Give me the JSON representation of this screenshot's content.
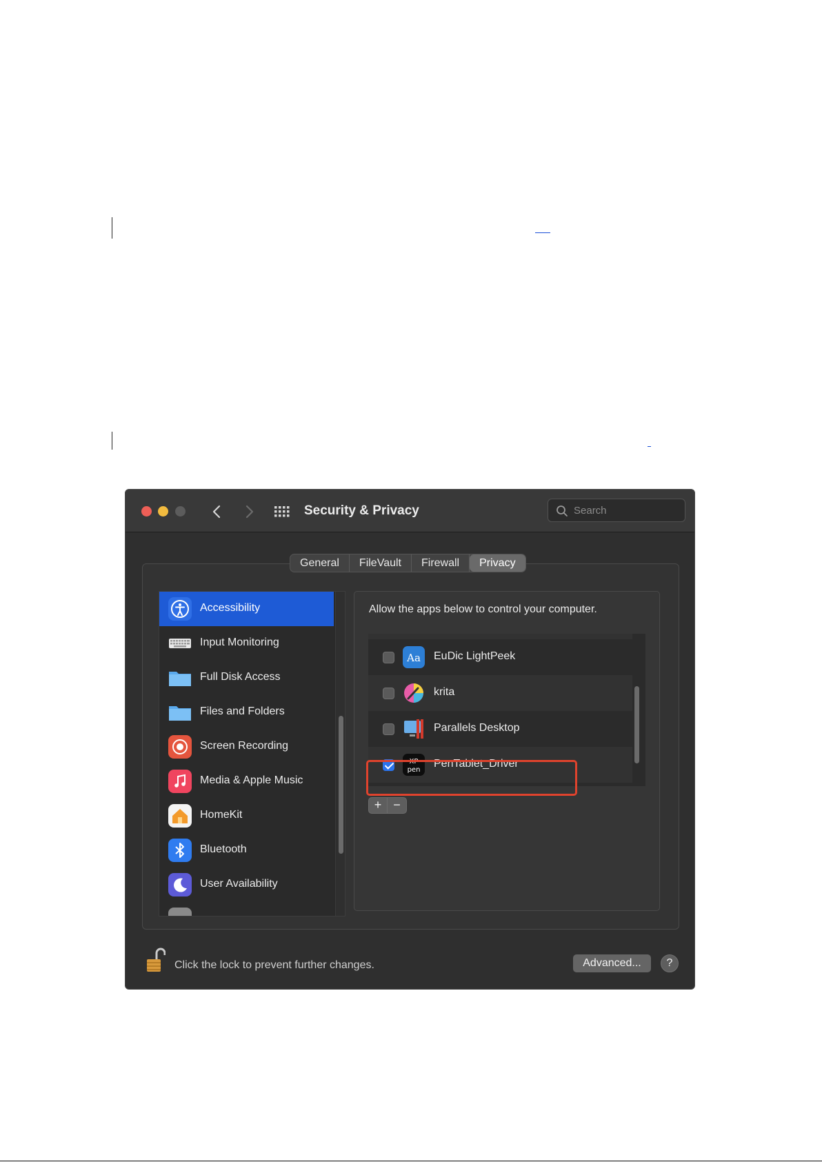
{
  "window": {
    "title": "Security & Privacy",
    "search_placeholder": "Search"
  },
  "tabs": [
    {
      "label": "General",
      "active": false
    },
    {
      "label": "FileVault",
      "active": false
    },
    {
      "label": "Firewall",
      "active": false
    },
    {
      "label": "Privacy",
      "active": true
    }
  ],
  "sidebar": {
    "items": [
      {
        "label": "Accessibility",
        "icon": "accessibility-icon",
        "selected": true
      },
      {
        "label": "Input Monitoring",
        "icon": "keyboard-icon",
        "selected": false
      },
      {
        "label": "Full Disk Access",
        "icon": "folder-icon",
        "selected": false
      },
      {
        "label": "Files and Folders",
        "icon": "folder-icon",
        "selected": false
      },
      {
        "label": "Screen Recording",
        "icon": "screen-recording-icon",
        "selected": false
      },
      {
        "label": "Media & Apple Music",
        "icon": "music-icon",
        "selected": false
      },
      {
        "label": "HomeKit",
        "icon": "home-icon",
        "selected": false
      },
      {
        "label": "Bluetooth",
        "icon": "bluetooth-icon",
        "selected": false
      },
      {
        "label": "User Availability",
        "icon": "moon-icon",
        "selected": false
      }
    ]
  },
  "content": {
    "description": "Allow the apps below to control your computer.",
    "apps": [
      {
        "label": "EuDic LightPeek",
        "checked": false,
        "icon": "eudic-icon"
      },
      {
        "label": "krita",
        "checked": false,
        "icon": "krita-icon"
      },
      {
        "label": "Parallels Desktop",
        "checked": false,
        "icon": "parallels-icon"
      },
      {
        "label": "PenTablet_Driver",
        "checked": true,
        "icon": "xppen-icon"
      }
    ],
    "add_label": "+",
    "remove_label": "−"
  },
  "footer": {
    "lock_text": "Click the lock to prevent further changes.",
    "advanced_label": "Advanced...",
    "help_label": "?"
  },
  "colors": {
    "accent": "#1e5bd6",
    "highlight_box": "#e0432d",
    "checkbox_checked": "#2a73ec"
  }
}
